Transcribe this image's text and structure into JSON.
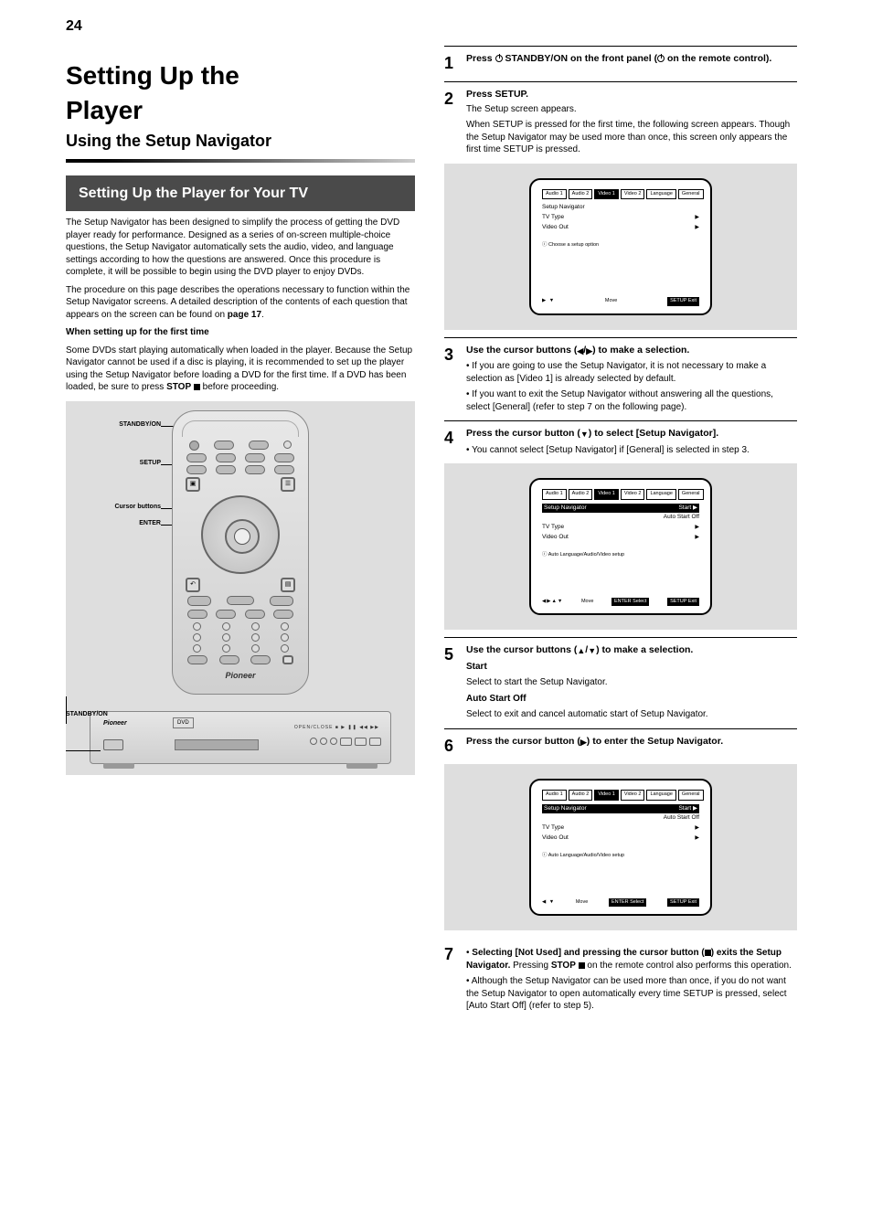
{
  "page_number": "24",
  "chapter_tag": "",
  "title": {
    "line1": "Setting Up the",
    "line2": "Player",
    "line3": "Using the Setup Navigator"
  },
  "section_heading": "Setting Up the Player for Your TV",
  "left_body": {
    "p1": "The Setup Navigator has been designed to simplify the process of getting the DVD player ready for performance. Designed as a series of on-screen multiple-choice questions, the Setup Navigator automatically sets the audio, video, and language settings according to how the questions are answered. Once this procedure is complete, it will be possible to begin using the DVD player to enjoy DVDs.",
    "p2": "The procedure on this page describes the operations necessary to function within the Setup Navigator screens. A detailed description of the contents of each question that appears on the screen can be found on ",
    "p2_bold": "page 17",
    "p2_after": ".",
    "when_heading": "When setting up for the first time",
    "when_p1": "Some DVDs start playing automatically when loaded in the player. Because the Setup Navigator cannot be used if a disc is playing, it is recommended to set up the player using the Setup Navigator before loading a DVD for the first time. If a DVD has been loaded, be sure to press STOP ■ before proceeding."
  },
  "remote_labels": {
    "standby": "STANDBY/ON",
    "setup": "SETUP",
    "cursor": "Cursor buttons",
    "enter": "ENTER"
  },
  "player_label": "STANDBY/ON",
  "steps": {
    "s1": {
      "num": "1",
      "title_pre": "Press ",
      "title_icon": "power",
      "title_post": " STANDBY/ON on the front panel (",
      "title_icon2": "power",
      "title_post2": " on the remote control)."
    },
    "s2": {
      "num": "2",
      "title": "Press SETUP.",
      "sub": "The Setup screen appears.",
      "p": "When SETUP is pressed for the first time, the following screen appears. Though the Setup Navigator may be used more than once, this screen only appears the first time SETUP is pressed."
    },
    "s3": {
      "num": "3",
      "title_pre": "Use the cursor buttons (",
      "title_post": ") to make a selection.",
      "b1": "If you are going to use the Setup Navigator, it is not necessary to make a selection as [Video 1] is already selected by default.",
      "b2": "If you want to exit the Setup Navigator without answering all the questions, select [General] (refer to step 7 on the following page)."
    },
    "s4": {
      "num": "4",
      "title_pre": "Press the cursor button (",
      "title_post": ") to select [Setup Navigator].",
      "bullet": "You cannot select [Setup Navigator] if [General] is selected in step 3."
    },
    "s5": {
      "num": "5",
      "title_pre": "Use the cursor buttons (",
      "title_post": ") to make a selection.",
      "opt1_label": "Start",
      "opt1_desc": "Select to start the Setup Navigator.",
      "opt2_label": "Auto Start Off",
      "opt2_desc": "Select to exit and cancel automatic start of Setup Navigator."
    },
    "s6": {
      "num": "6",
      "title_pre": "Press the cursor button (",
      "title_post": ") to enter the Setup Navigator."
    },
    "s7": {
      "num": "7",
      "title_seg1": "Selecting [Not Used] and pressing the cursor button (",
      "title_seg2": ") exits the Setup Navigator.",
      "note": "Although the Setup Navigator can be used more than once, if you do not want the Setup Navigator to open automatically every time SETUP is pressed, select [Auto Start Off] (refer to step 5)."
    }
  },
  "tv": {
    "tabs": [
      "Audio 1",
      "Audio 2",
      "Video 1",
      "Video 2",
      "Language",
      "General"
    ],
    "screen1": {
      "row1": {
        "l": "Setup Navigator",
        "r": ""
      },
      "row2": {
        "l": "TV Type",
        "r": "▶"
      },
      "row3": {
        "l": "Video Out",
        "r": "▶"
      },
      "hint": "Choose a setup option",
      "footer_move": "Move",
      "footer_exit": "SETUP Exit"
    },
    "screen2": {
      "row1": {
        "l": "Setup Navigator",
        "r": "Start ▶"
      },
      "row1b": {
        "l": "",
        "r": "Auto Start Off"
      },
      "row2": {
        "l": "TV Type",
        "r": "▶"
      },
      "row3": {
        "l": "Video Out",
        "r": "▶"
      },
      "hint": "Auto Language/Audio/Video setup",
      "footer_move": "Move",
      "footer_enter": "ENTER Select",
      "footer_exit": "SETUP Exit"
    },
    "screen3": {
      "row1": {
        "l": "Setup Navigator",
        "r": "Start ▶"
      },
      "row1b": {
        "l": "",
        "r": "Auto Start Off"
      },
      "row2": {
        "l": "TV Type",
        "r": "▶"
      },
      "row3": {
        "l": "Video Out",
        "r": "▶"
      },
      "hint": "Auto Language/Audio/Video setup",
      "footer_move": "Move",
      "footer_enter": "ENTER Select",
      "footer_exit": "SETUP Exit"
    }
  },
  "remote_logo": "Pioneer",
  "player_logo": "Pioneer",
  "player_panel_labels": "OPEN/CLOSE    ■    ▶    ❚❚   ◀◀  ▶▶",
  "dvd_badge": "DVD"
}
